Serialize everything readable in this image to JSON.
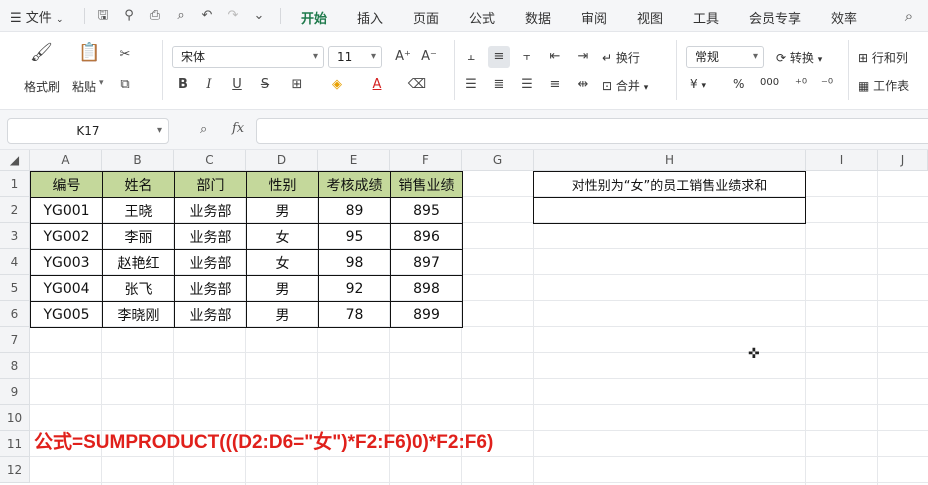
{
  "menu": {
    "file_label": "文件",
    "tabs": [
      "开始",
      "插入",
      "页面",
      "公式",
      "数据",
      "审阅",
      "视图",
      "工具",
      "会员专享",
      "效率"
    ],
    "active_tab": "开始"
  },
  "ribbon": {
    "format_painter": "格式刷",
    "paste": "粘贴",
    "font_name": "宋体",
    "font_size": "11",
    "wrap_text": "换行",
    "merge": "合并",
    "number_format": "常规",
    "convert": "转换",
    "rows_cols": "行和列",
    "worksheet": "工作表",
    "currency_symbol": "¥",
    "percent_symbol": "%",
    "thousands_symbol": "000"
  },
  "formula_bar": {
    "name_box": "K17",
    "fx_label": "fx",
    "content": ""
  },
  "grid": {
    "columns": [
      "A",
      "B",
      "C",
      "D",
      "E",
      "F",
      "G",
      "H",
      "I",
      "J"
    ],
    "rows": [
      "1",
      "2",
      "3",
      "4",
      "5",
      "6",
      "7",
      "8",
      "9",
      "10",
      "11",
      "12"
    ],
    "table_headers": [
      "编号",
      "姓名",
      "部门",
      "性别",
      "考核成绩",
      "销售业绩"
    ],
    "table_rows": [
      [
        "YG001",
        "王晓",
        "业务部",
        "男",
        "89",
        "895"
      ],
      [
        "YG002",
        "李丽",
        "业务部",
        "女",
        "95",
        "896"
      ],
      [
        "YG003",
        "赵艳红",
        "业务部",
        "女",
        "98",
        "897"
      ],
      [
        "YG004",
        "张飞",
        "业务部",
        "男",
        "92",
        "898"
      ],
      [
        "YG005",
        "李晓刚",
        "业务部",
        "男",
        "78",
        "899"
      ]
    ],
    "h1_label": "对性别为“女”的员工销售业绩求和",
    "h2_value": "",
    "formula_note": "公式=SUMPRODUCT(((D2:D6=\"女\")*F2:F6)0)*F2:F6)"
  },
  "colors": {
    "accent": "#1f7a4c",
    "header_fill": "#c4d89b",
    "formula_red": "#e0201b"
  }
}
